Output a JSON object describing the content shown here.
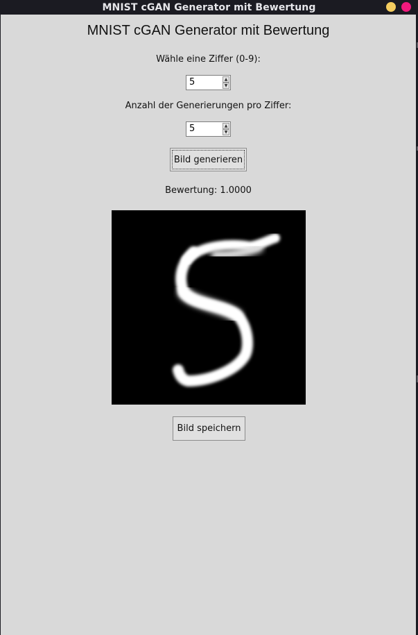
{
  "window": {
    "title": "MNIST cGAN Generator mit Bewertung",
    "minimize_icon": "yellow-circle-icon",
    "close_icon": "pink-circle-icon"
  },
  "app": {
    "heading": "MNIST cGAN Generator mit Bewertung",
    "digit_label": "Wähle eine Ziffer (0-9):",
    "digit_value": "5",
    "count_label": "Anzahl der Generierungen pro Ziffer:",
    "count_value": "5",
    "generate_button": "Bild generieren",
    "score_text": "Bewertung: 1.0000",
    "save_button": "Bild speichern",
    "generated_image": {
      "description_icon": "handwritten-digit-five",
      "digit": "5",
      "background": "#000000",
      "stroke_color": "#ffffff"
    }
  },
  "colors": {
    "window_bg": "#d9d9d9",
    "titlebar_bg": "#1b1b22",
    "minimize": "#f4cd5f",
    "close": "#f0197d"
  }
}
